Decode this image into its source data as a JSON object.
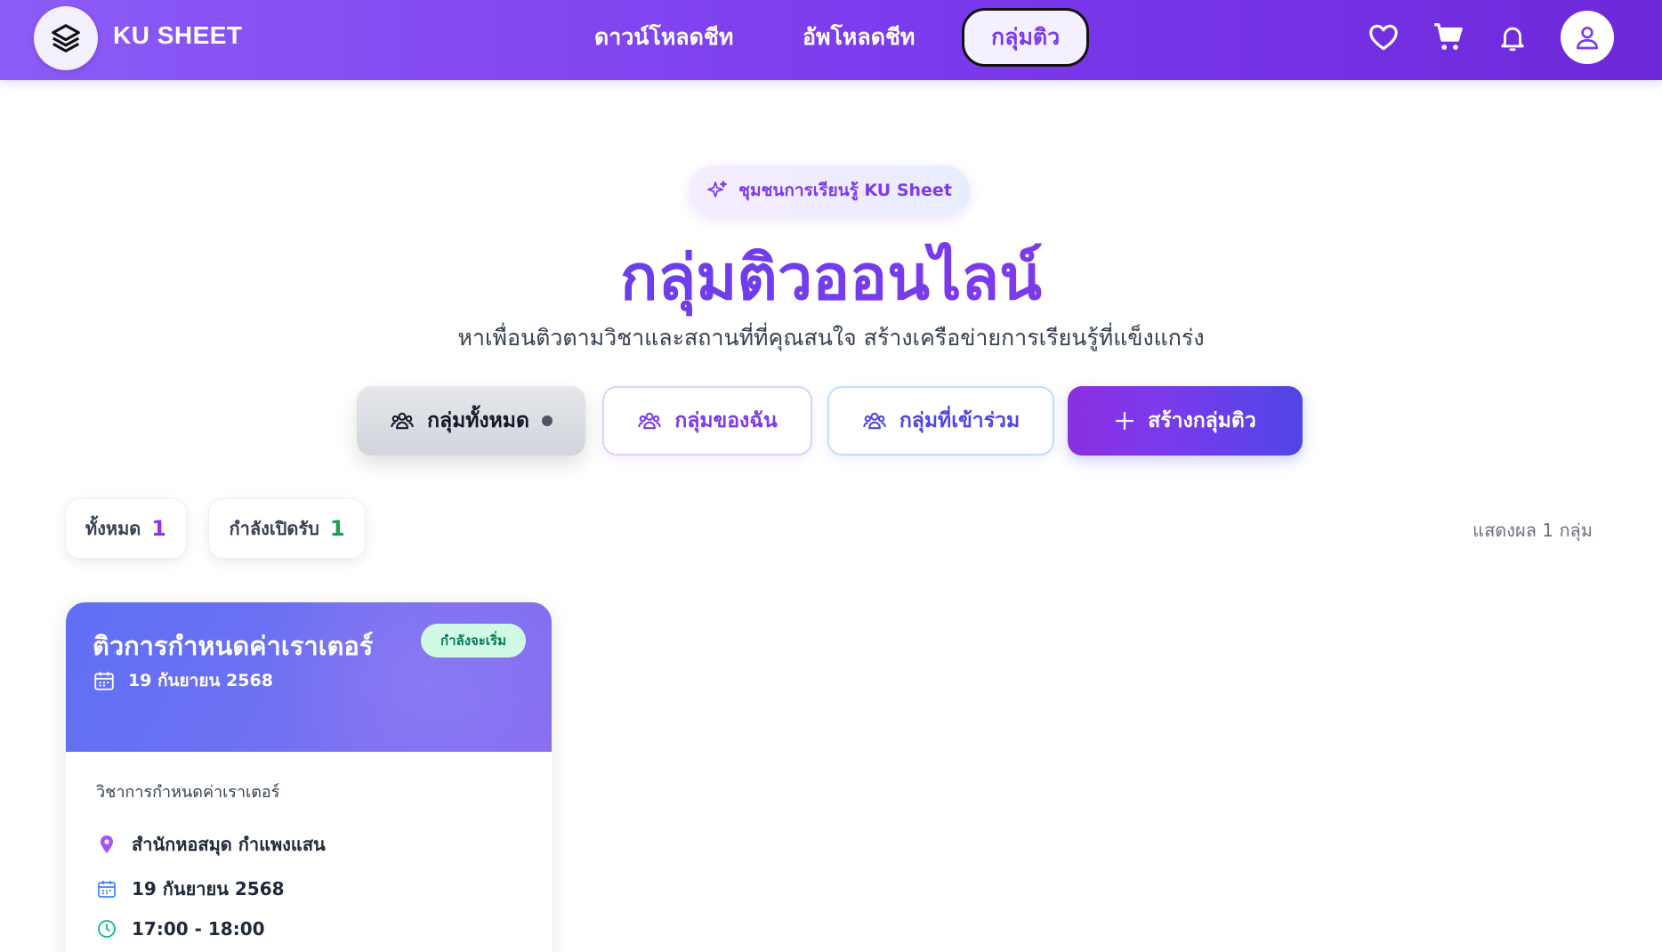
{
  "navbar": {
    "brand": "KU SHEET",
    "links": [
      "ดาวน์โหลดชีท",
      "อัพโหลดชีท",
      "กลุ่มติว"
    ],
    "active_link": "กลุ่มติว",
    "icons": [
      "heart-icon",
      "cart-icon",
      "bell-icon",
      "user-icon"
    ]
  },
  "hero": {
    "pill": "ชุมชนการเรียนรู้ KU Sheet",
    "title": "กลุ่มติวออนไลน์",
    "subtitle": "หาเพื่อนติวตามวิชาและสถานที่ที่คุณสนใจ สร้างเครือข่ายการเรียนรู้ที่แข็งแกร่ง"
  },
  "tabs": {
    "all": "กลุ่มทั้งหมด",
    "mine": "กลุ่มของฉัน",
    "joined": "กลุ่มที่เข้าร่วม",
    "create": "สร้างกลุ่มติว"
  },
  "stats": {
    "total_label": "ทั้งหมด",
    "total_value": "1",
    "open_label": "กำลังเปิดรับ",
    "open_value": "1",
    "result_text": "แสดงผล 1 กลุ่ม"
  },
  "card": {
    "title": "ติวการกำหนดค่าเราเตอร์",
    "status": "กำลังจะเริ่ม",
    "date_header": "19 กันยายน 2568",
    "subject": "วิชาการกำหนดค่าเราเตอร์",
    "location": "สำนักหอสมุด กำแพงแสน",
    "date": "19 กันยายน 2568",
    "time": "17:00 - 18:00"
  },
  "colors": {
    "primary": "#7c3aed",
    "accent_blue": "#4f46e5",
    "status_green": "#047857"
  }
}
